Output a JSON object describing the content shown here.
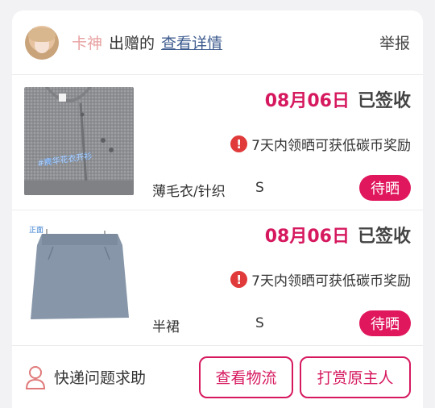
{
  "header": {
    "user_name": "卡神",
    "gift_text": "出赠的",
    "details_link": "查看详情",
    "report": "举报"
  },
  "items": [
    {
      "date": "08月06日",
      "status": "已签收",
      "notice": "7天内领晒可获低碳币奖励",
      "category": "薄毛衣/针织",
      "size": "S",
      "action": "待晒",
      "image_caption": "#麂华花衣开衫"
    },
    {
      "date": "08月06日",
      "status": "已签收",
      "notice": "7天内领晒可获低碳币奖励",
      "category": "半裙",
      "size": "S",
      "action": "待晒",
      "image_tag": "正面"
    }
  ],
  "footer": {
    "help_label": "快递问题求助",
    "logistics_button": "查看物流",
    "tip_button": "打赏原主人"
  },
  "colors": {
    "accent": "#d6195f",
    "username": "#e8a0a0",
    "link": "#3f5c8f",
    "warning": "#e03a3a"
  },
  "icons": [
    "avatar",
    "warning-icon",
    "person-icon"
  ]
}
